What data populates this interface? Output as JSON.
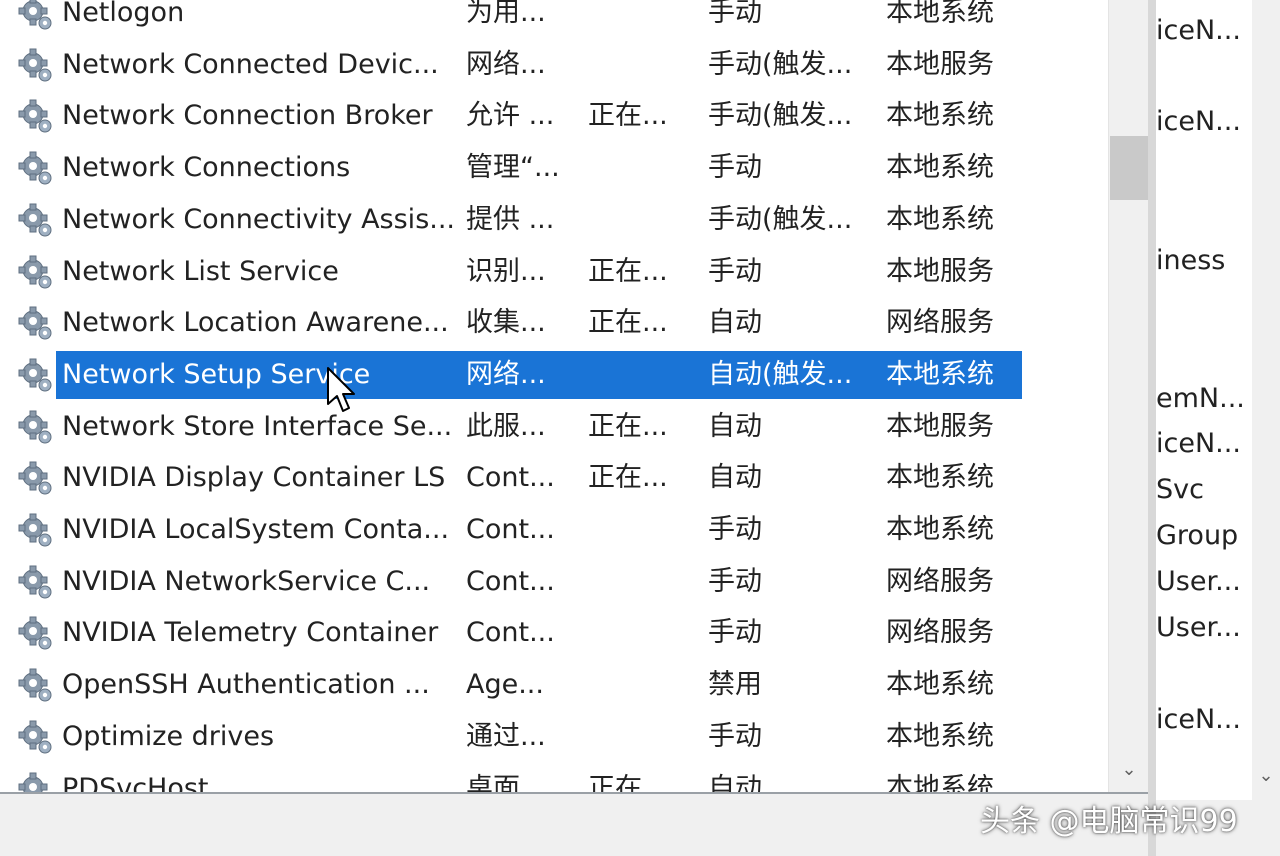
{
  "services": [
    {
      "name": "Netlogon",
      "description": "为用...",
      "status": "",
      "startup": "手动",
      "logon": "本地系统",
      "selected": false
    },
    {
      "name": "Network Connected Devic...",
      "description": "网络...",
      "status": "",
      "startup": "手动(触发...",
      "logon": "本地服务",
      "selected": false
    },
    {
      "name": "Network Connection Broker",
      "description": "允许 ...",
      "status": "正在...",
      "startup": "手动(触发...",
      "logon": "本地系统",
      "selected": false
    },
    {
      "name": "Network Connections",
      "description": "管理“...",
      "status": "",
      "startup": "手动",
      "logon": "本地系统",
      "selected": false
    },
    {
      "name": "Network Connectivity Assis...",
      "description": "提供 ...",
      "status": "",
      "startup": "手动(触发...",
      "logon": "本地系统",
      "selected": false
    },
    {
      "name": "Network List Service",
      "description": "识别...",
      "status": "正在...",
      "startup": "手动",
      "logon": "本地服务",
      "selected": false
    },
    {
      "name": "Network Location Awarene...",
      "description": "收集...",
      "status": "正在...",
      "startup": "自动",
      "logon": "网络服务",
      "selected": false
    },
    {
      "name": "Network Setup Service",
      "description": "网络...",
      "status": "",
      "startup": "自动(触发...",
      "logon": "本地系统",
      "selected": true
    },
    {
      "name": "Network Store Interface Se...",
      "description": "此服...",
      "status": "正在...",
      "startup": "自动",
      "logon": "本地服务",
      "selected": false
    },
    {
      "name": "NVIDIA Display Container LS",
      "description": "Cont...",
      "status": "正在...",
      "startup": "自动",
      "logon": "本地系统",
      "selected": false
    },
    {
      "name": "NVIDIA LocalSystem Conta...",
      "description": "Cont...",
      "status": "",
      "startup": "手动",
      "logon": "本地系统",
      "selected": false
    },
    {
      "name": "NVIDIA NetworkService C...",
      "description": "Cont...",
      "status": "",
      "startup": "手动",
      "logon": "网络服务",
      "selected": false
    },
    {
      "name": "NVIDIA Telemetry Container",
      "description": "Cont...",
      "status": "",
      "startup": "手动",
      "logon": "网络服务",
      "selected": false
    },
    {
      "name": "OpenSSH Authentication ...",
      "description": "Age...",
      "status": "",
      "startup": "禁用",
      "logon": "本地系统",
      "selected": false
    },
    {
      "name": "Optimize drives",
      "description": "通过...",
      "status": "",
      "startup": "手动",
      "logon": "本地系统",
      "selected": false
    },
    {
      "name": "PDSvcHost",
      "description": "桌面...",
      "status": "正在...",
      "startup": "自动",
      "logon": "本地系统",
      "selected": false
    }
  ],
  "right_panel": {
    "lines": [
      "iceN...",
      "iceN...",
      "iness",
      "emN...",
      "iceN...",
      "Svc",
      "Group",
      "User...",
      "User...",
      "iceN..."
    ]
  },
  "scroll": {
    "down_arrow": "⌄"
  },
  "watermark": "头条 @电脑常识99",
  "colors": {
    "selection": "#1a74d6",
    "list_bg": "#ffffff",
    "window_bg": "#f0f0f0"
  },
  "icons": {
    "service": "gear-icon",
    "cursor": "mouse-pointer-icon"
  }
}
